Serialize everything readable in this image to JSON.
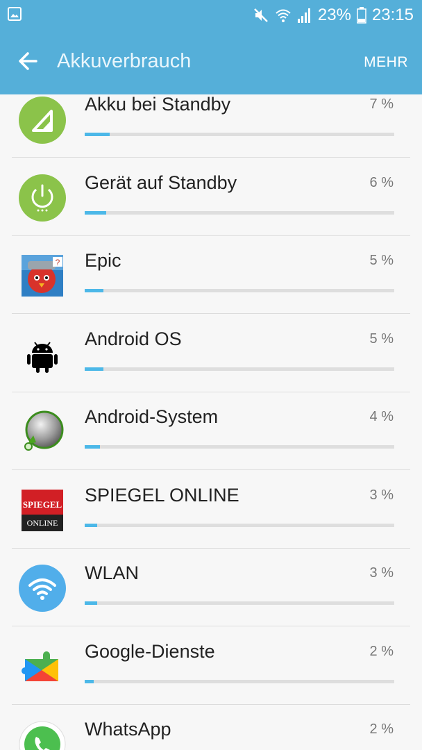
{
  "status_bar": {
    "battery_percent": "23%",
    "time": "23:15"
  },
  "app_bar": {
    "title": "Akkuverbrauch",
    "more_label": "MEHR"
  },
  "colors": {
    "accent": "#55afd9",
    "bar_fill": "#4cb8e8",
    "bar_track": "#dedede"
  },
  "items": [
    {
      "name": "Akku bei Standby",
      "percent_label": "7 %",
      "fraction": 0.08,
      "icon": "battery-standby-icon"
    },
    {
      "name": "Gerät auf Standby",
      "percent_label": "6 %",
      "fraction": 0.07,
      "icon": "power-standby-icon"
    },
    {
      "name": "Epic",
      "percent_label": "5 %",
      "fraction": 0.06,
      "icon": "epic-app-icon"
    },
    {
      "name": "Android OS",
      "percent_label": "5 %",
      "fraction": 0.06,
      "icon": "android-icon"
    },
    {
      "name": "Android-System",
      "percent_label": "4 %",
      "fraction": 0.05,
      "icon": "android-system-icon"
    },
    {
      "name": "SPIEGEL ONLINE",
      "percent_label": "3 %",
      "fraction": 0.04,
      "icon": "spiegel-online-icon",
      "icon_text_1": "SPIEGEL",
      "icon_text_2": "ONLINE"
    },
    {
      "name": "WLAN",
      "percent_label": "3 %",
      "fraction": 0.04,
      "icon": "wifi-icon"
    },
    {
      "name": "Google-Dienste",
      "percent_label": "2 %",
      "fraction": 0.03,
      "icon": "google-play-services-icon"
    },
    {
      "name": "WhatsApp",
      "percent_label": "2 %",
      "fraction": 0.03,
      "icon": "whatsapp-icon"
    }
  ]
}
